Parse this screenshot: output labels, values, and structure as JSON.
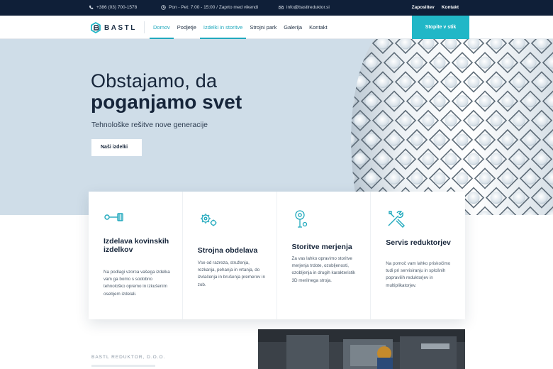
{
  "topbar": {
    "phone": "+386 (03) 700-1578",
    "hours": "Pon - Pet: 7:00 - 15:00 / Zaprto med vikendi",
    "email": "info@bastlreduktor.si",
    "links": [
      "Zaposlitev",
      "Kontakt"
    ]
  },
  "brand": {
    "name": "BASTL"
  },
  "nav": {
    "items": [
      {
        "label": "Domov",
        "active": true
      },
      {
        "label": "Podjetje",
        "active": false
      },
      {
        "label": "Izdelki in storitve",
        "active": true
      },
      {
        "label": "Strojni park",
        "active": false
      },
      {
        "label": "Galerija",
        "active": false
      },
      {
        "label": "Kontakt",
        "active": false
      }
    ],
    "cta": "Stopite v stik"
  },
  "hero": {
    "title_line1": "Obstajamo, da",
    "title_line2": "poganjamo svet",
    "subtitle": "Tehnološke rešitve nove generacije",
    "button": "Naši izdelki"
  },
  "services": [
    {
      "icon": "piston-icon",
      "title": "Izdelava kovinskih izdelkov",
      "text": "Na podlagi vzorca vašega izdelka vam ga bomo s sodobno tehnološko opremo in izkušenim osebjem izdelali."
    },
    {
      "icon": "gears-icon",
      "title": "Strojna obdelava",
      "text": "Vse od razreza, struženja, rezkanja, pehanja in vrtanja, do izvlačenja in brušenja premerov in zob."
    },
    {
      "icon": "measurement-icon",
      "title": "Storitve merjenja",
      "text": "Za vas lahko opravimo storitve merjenja trdote, ozobljenosti, ozobljenja in drugih karakteristik 3D merilnega stroja."
    },
    {
      "icon": "tools-icon",
      "title": "Servis reduktorjev",
      "text": "Na pomoč vam lahko priskočimo tudi pri servisiranju in splošnih popravilih reduktorjev in multiplikatorjev."
    }
  ],
  "about": {
    "company": "BASTL REDUKTOR, D.O.O."
  },
  "colors": {
    "accent": "#21b7c7",
    "dark": "#0f1f38",
    "hero_bg": "#cfdde8"
  }
}
